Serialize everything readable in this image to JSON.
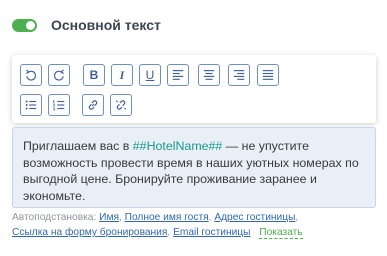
{
  "section": {
    "toggle_on": true,
    "title": "Основной текст"
  },
  "toolbar": {
    "buttons": [
      {
        "name": "undo-button",
        "icon": "undo-icon"
      },
      {
        "name": "redo-button",
        "icon": "redo-icon"
      },
      {
        "name": "bold-button",
        "icon": "bold-icon",
        "letter": "B"
      },
      {
        "name": "italic-button",
        "icon": "italic-icon",
        "letter": "I"
      },
      {
        "name": "underline-button",
        "icon": "underline-icon",
        "letter": "U"
      },
      {
        "name": "align-left-button",
        "icon": "align-left-icon"
      },
      {
        "name": "align-center-button",
        "icon": "align-center-icon"
      },
      {
        "name": "align-right-button",
        "icon": "align-right-icon"
      },
      {
        "name": "align-justify-button",
        "icon": "align-justify-icon"
      },
      {
        "name": "bulleted-list-button",
        "icon": "bulleted-list-icon"
      },
      {
        "name": "numbered-list-button",
        "icon": "numbered-list-icon"
      },
      {
        "name": "insert-link-button",
        "icon": "link-icon"
      },
      {
        "name": "remove-link-button",
        "icon": "unlink-icon"
      }
    ]
  },
  "editor": {
    "text_before": "Приглашаем вас в ",
    "macro": "##HotelName##",
    "text_after": " — не упустите возможность провести время в наших уютных номерах по выгодной цене. Бронируйте проживание заранее и экономьте."
  },
  "substitutions": {
    "label": "Автоподстановка:",
    "links": [
      "Имя",
      "Полное имя гостя",
      "Адрес гостиницы",
      "Ссылка на форму бронирования",
      "Email гостиницы"
    ],
    "show_label": "Показать"
  },
  "colors": {
    "accent_green": "#4caf50",
    "toolbar_icon": "#3e5f97",
    "macro_teal": "#1a9a8e",
    "link_blue": "#2f69b2",
    "editor_bg": "#e9eff6"
  }
}
